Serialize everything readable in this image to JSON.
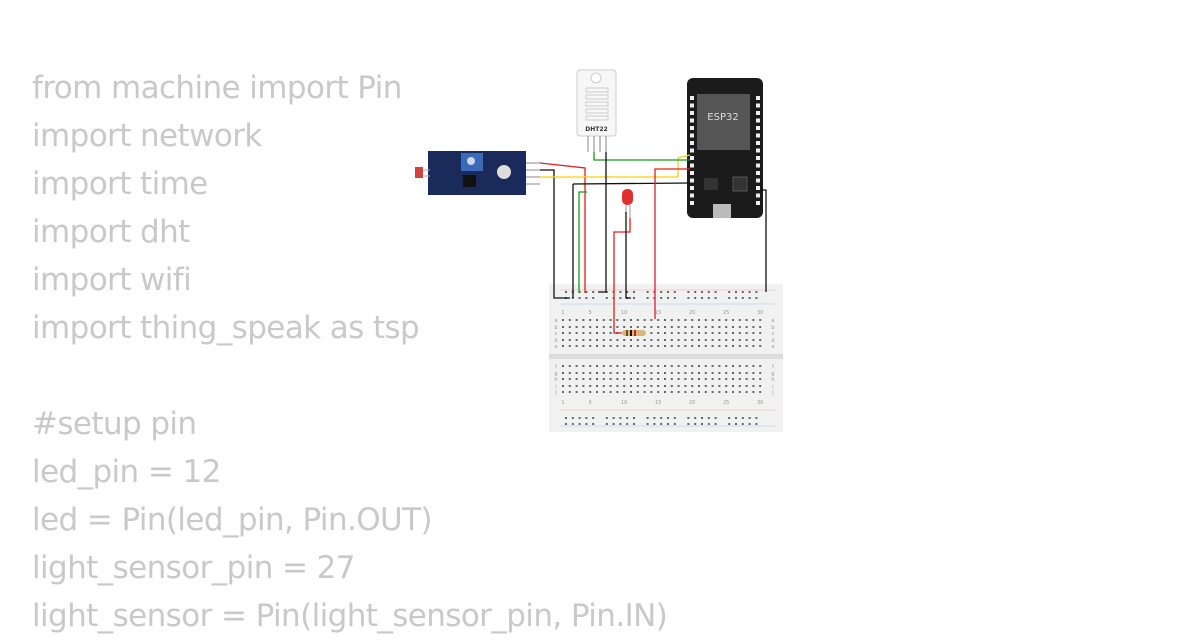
{
  "code_lines": [
    "from machine import Pin",
    "import network",
    "import time",
    "import dht",
    "import wifi",
    "import thing_speak as tsp",
    "",
    "#setup pin",
    "led_pin = 12",
    "led = Pin(led_pin, Pin.OUT)",
    "light_sensor_pin = 27",
    "light_sensor = Pin(light_sensor_pin, Pin.IN)"
  ],
  "circuit": {
    "dht_label": "DHT22",
    "esp_label": "ESP32",
    "breadboard_columns": [
      "1",
      "5",
      "10",
      "15",
      "20",
      "25",
      "30"
    ],
    "breadboard_rows_top": [
      "a",
      "b",
      "c",
      "d",
      "e"
    ],
    "breadboard_rows_bottom": [
      "f",
      "g",
      "h",
      "i",
      "j"
    ],
    "wire_colors": {
      "red": "#e02020",
      "black": "#111111",
      "green": "#1a9a1a",
      "yellow": "#f2d400"
    }
  }
}
